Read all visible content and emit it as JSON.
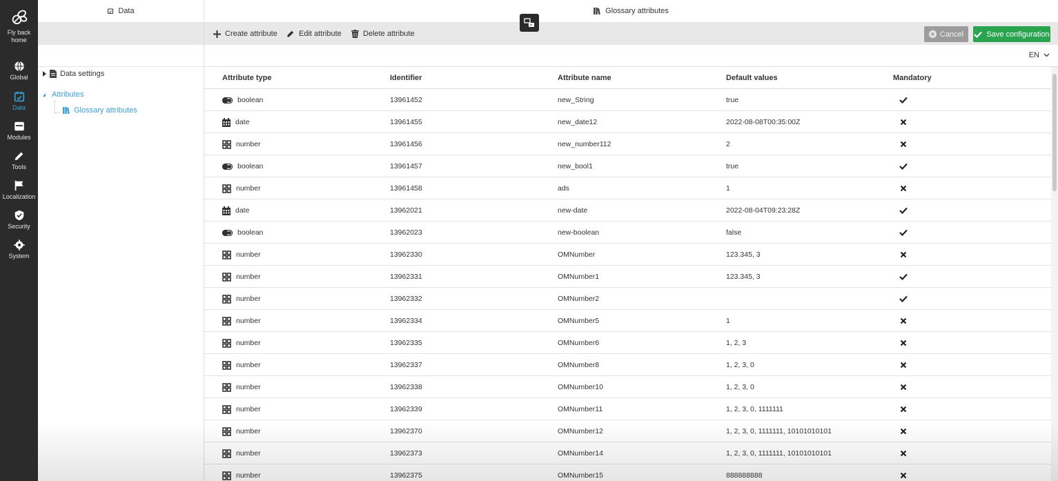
{
  "nav": {
    "items": [
      {
        "label": "Fly back home",
        "icon": "bee-icon"
      },
      {
        "label": "Global",
        "icon": "globe-icon"
      },
      {
        "label": "Data",
        "icon": "data-icon",
        "active": true
      },
      {
        "label": "Modules",
        "icon": "modules-icon"
      },
      {
        "label": "Tools",
        "icon": "pencil-icon"
      },
      {
        "label": "Localization",
        "icon": "flag-icon"
      },
      {
        "label": "Security",
        "icon": "shield-icon"
      },
      {
        "label": "System",
        "icon": "gear-icon"
      }
    ],
    "home_line1": "Fly back",
    "home_line2": "home"
  },
  "tree": {
    "title": "Data",
    "items": [
      {
        "label": "Data settings"
      },
      {
        "label": "Attributes"
      },
      {
        "label": "Glossary attributes"
      }
    ]
  },
  "main": {
    "title": "Glossary attributes",
    "toolbar": {
      "create": "Create attribute",
      "edit": "Edit attribute",
      "delete": "Delete attribute",
      "cancel": "Cancel",
      "save": "Save configuration"
    },
    "language": "EN"
  },
  "table": {
    "columns": [
      "Attribute type",
      "Identifier",
      "Attribute name",
      "Default values",
      "Mandatory"
    ],
    "rows": [
      {
        "type": "boolean",
        "id": "13961452",
        "name": "new_String",
        "default": "true",
        "mandatory": true
      },
      {
        "type": "date",
        "id": "13961455",
        "name": "new_date12",
        "default": "2022-08-08T00:35:00Z",
        "mandatory": false
      },
      {
        "type": "number",
        "id": "13961456",
        "name": "new_number112",
        "default": "2",
        "mandatory": false
      },
      {
        "type": "boolean",
        "id": "13961457",
        "name": "new_bool1",
        "default": "true",
        "mandatory": true
      },
      {
        "type": "number",
        "id": "13961458",
        "name": "ads",
        "default": "1",
        "mandatory": false
      },
      {
        "type": "date",
        "id": "13962021",
        "name": "new-date",
        "default": "2022-08-04T09:23:28Z",
        "mandatory": true
      },
      {
        "type": "boolean",
        "id": "13962023",
        "name": "new-boolean",
        "default": "false",
        "mandatory": true
      },
      {
        "type": "number",
        "id": "13962330",
        "name": "OMNumber",
        "default": "123.345, 3",
        "mandatory": false
      },
      {
        "type": "number",
        "id": "13962331",
        "name": "OMNumber1",
        "default": "123.345, 3",
        "mandatory": true
      },
      {
        "type": "number",
        "id": "13962332",
        "name": "OMNumber2",
        "default": "",
        "mandatory": true
      },
      {
        "type": "number",
        "id": "13962334",
        "name": "OMNumber5",
        "default": "1",
        "mandatory": false
      },
      {
        "type": "number",
        "id": "13962335",
        "name": "OMNumber6",
        "default": "1, 2, 3",
        "mandatory": false
      },
      {
        "type": "number",
        "id": "13962337",
        "name": "OMNumber8",
        "default": "1, 2, 3, 0",
        "mandatory": false
      },
      {
        "type": "number",
        "id": "13962338",
        "name": "OMNumber10",
        "default": "1, 2, 3, 0",
        "mandatory": false
      },
      {
        "type": "number",
        "id": "13962339",
        "name": "OMNumber11",
        "default": "1, 2, 3, 0, 1111111",
        "mandatory": false
      },
      {
        "type": "number",
        "id": "13962370",
        "name": "OMNumber12",
        "default": "1, 2, 3, 0, 1111111, 10101010101",
        "mandatory": false
      },
      {
        "type": "number",
        "id": "13962373",
        "name": "OMNumber14",
        "default": "1, 2, 3, 0, 1111111, 10101010101",
        "mandatory": false
      },
      {
        "type": "number",
        "id": "13962375",
        "name": "OMNumber15",
        "default": "888888888",
        "mandatory": false
      }
    ]
  },
  "colors": {
    "nav_bg": "#2b2b2b",
    "accent": "#3aa0d8",
    "save_green": "#2aa44f",
    "cancel_gray": "#9c9c9c"
  }
}
